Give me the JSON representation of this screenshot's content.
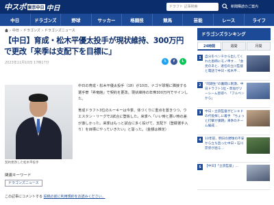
{
  "header": {
    "logo_main": "中スポ",
    "logo_sub": "東京中日",
    "logo_brand": "中日",
    "search_placeholder": "ドラフト 記事検索",
    "member_link": "新聞購読のご案内"
  },
  "nav": [
    "中日",
    "ドラゴンズ",
    "野球",
    "サッカー",
    "格闘技",
    "競馬",
    "芸能",
    "レース",
    "ライフ"
  ],
  "breadcrumb": {
    "items": [
      "中日",
      "ドラゴンズ",
      "ドラゴンズニュース"
    ],
    "separator": "›"
  },
  "article": {
    "title": "【中日】育成・松木平優太投手が現状維持、300万円で更改「来季は支配下を目標に」",
    "date": "2023年11月10日 17時17分",
    "photo_caption": "契約更改した松木平投手",
    "paragraphs": [
      "中日の育成・松木平優太投手（18）が10日、ナゴヤ球場に隣接する選手寮「昇竜館」で契約を更改。現状維持の年俸300万円でサインした。",
      "育成ドラフト3位のルーキーは今季、体づくりに重点を置きつつ、ウエスタン・リーグで2試合に登板した。来季へ「いい時と悪い時の差が激しかった。来季はもっと試合に多く投げて、支配下（登録選手入り）を目標にやっていきたい」と誓った。（金額は推定）"
    ],
    "keyword_label": "関連キーワード",
    "keyword_tag": "ドラゴンズニュース",
    "comment_prefix": "この記事にコメントする",
    "comment_link": "投稿の前に利用規約をお読みください。"
  },
  "share": {
    "twitter": "𝕏",
    "facebook": "f",
    "line": "L"
  },
  "sidebar": {
    "ranking_title": "ドラゴンズランキング",
    "tabs": [
      "24時間",
      "週間",
      "月間"
    ],
    "items": [
      {
        "rank": "1",
        "text": "自分をベンチから出してくれた恩師にモノ申す…「会見のあと、退任の立川監督と電話で中日・松木平…"
      },
      {
        "rank": "2",
        "text": "“同期生”の奮闘に刺激、中日ドラフト1位・草加がツーシーム習得へ 「ブルペンから」"
      },
      {
        "rank": "3",
        "text": "中日・立浪監督がビシエドの代役探しに着手 「ちょっと打撃が課題」来季のチーム編成…"
      },
      {
        "rank": "4",
        "text": "10年前、明日の野球の不安から立ち直った中日・石川昂弥が語る…"
      },
      {
        "rank": "5",
        "text": "【中日】「立浪監督」…"
      }
    ]
  },
  "colors": {
    "header_bg": "#0b2d6b",
    "nav_bg": "#1d4a96",
    "title_color": "#0b2d6b"
  }
}
